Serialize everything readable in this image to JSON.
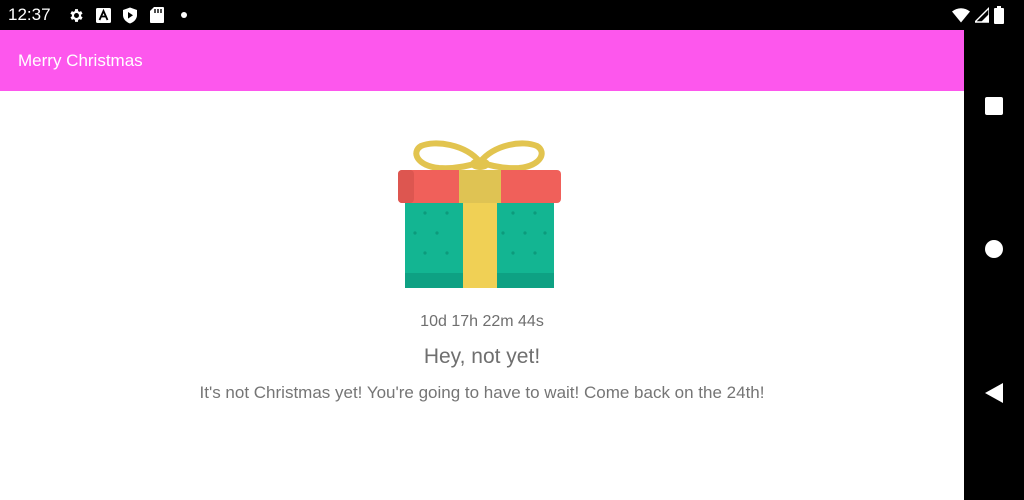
{
  "status_bar": {
    "time": "12:37",
    "left_icons": [
      "settings-icon",
      "font-a-icon",
      "shield-play-icon",
      "sd-card-icon",
      "dot-icon"
    ],
    "right_icons": [
      "wifi-icon",
      "cellular-signal-icon",
      "battery-icon"
    ]
  },
  "toolbar": {
    "title": "Merry Christmas",
    "color": "#fd57ed"
  },
  "main": {
    "image": "gift-box-icon",
    "countdown": "10d 17h 22m 44s",
    "headline": "Hey, not yet!",
    "message": "It's not Christmas yet! You're going to have to wait! Come back on the 24th!"
  },
  "nav_bar": {
    "buttons": [
      "recents-button",
      "home-button",
      "back-button"
    ]
  }
}
